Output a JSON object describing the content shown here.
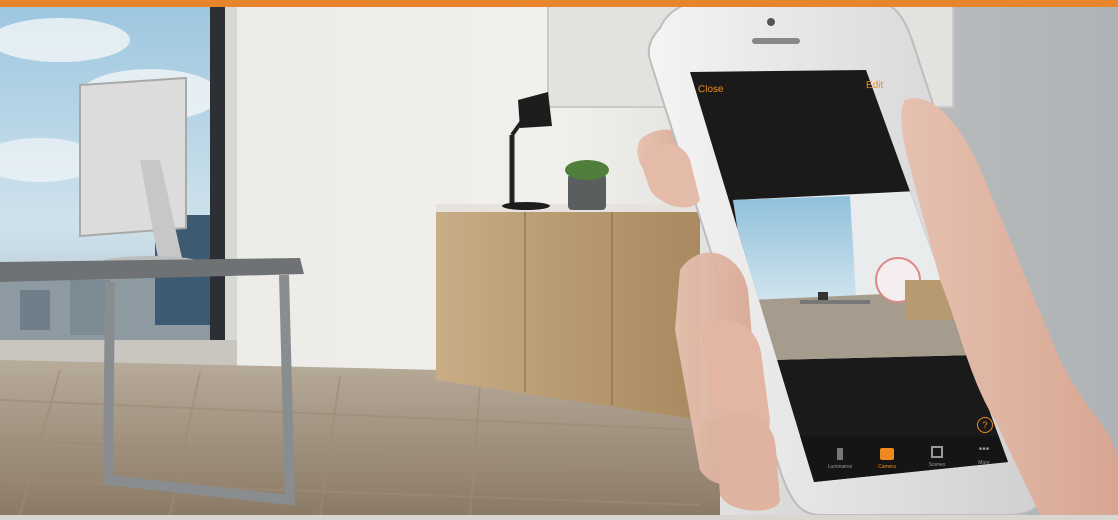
{
  "colors": {
    "accent": "#e8842c",
    "app_background": "#1a1a1a",
    "app_accent_text": "#f08a1e"
  },
  "phone_app": {
    "header": {
      "close_label": "Close",
      "edit_label": "Edit"
    },
    "tabs": [
      {
        "label": "Luminaires",
        "icon": "lamp-icon"
      },
      {
        "label": "Camera",
        "icon": "camera-icon"
      },
      {
        "label": "Scenes",
        "icon": "scenes-icon"
      },
      {
        "label": "More",
        "icon": "more-icon"
      }
    ],
    "active_tab": "Camera",
    "help_icon": "question-circle-icon"
  }
}
